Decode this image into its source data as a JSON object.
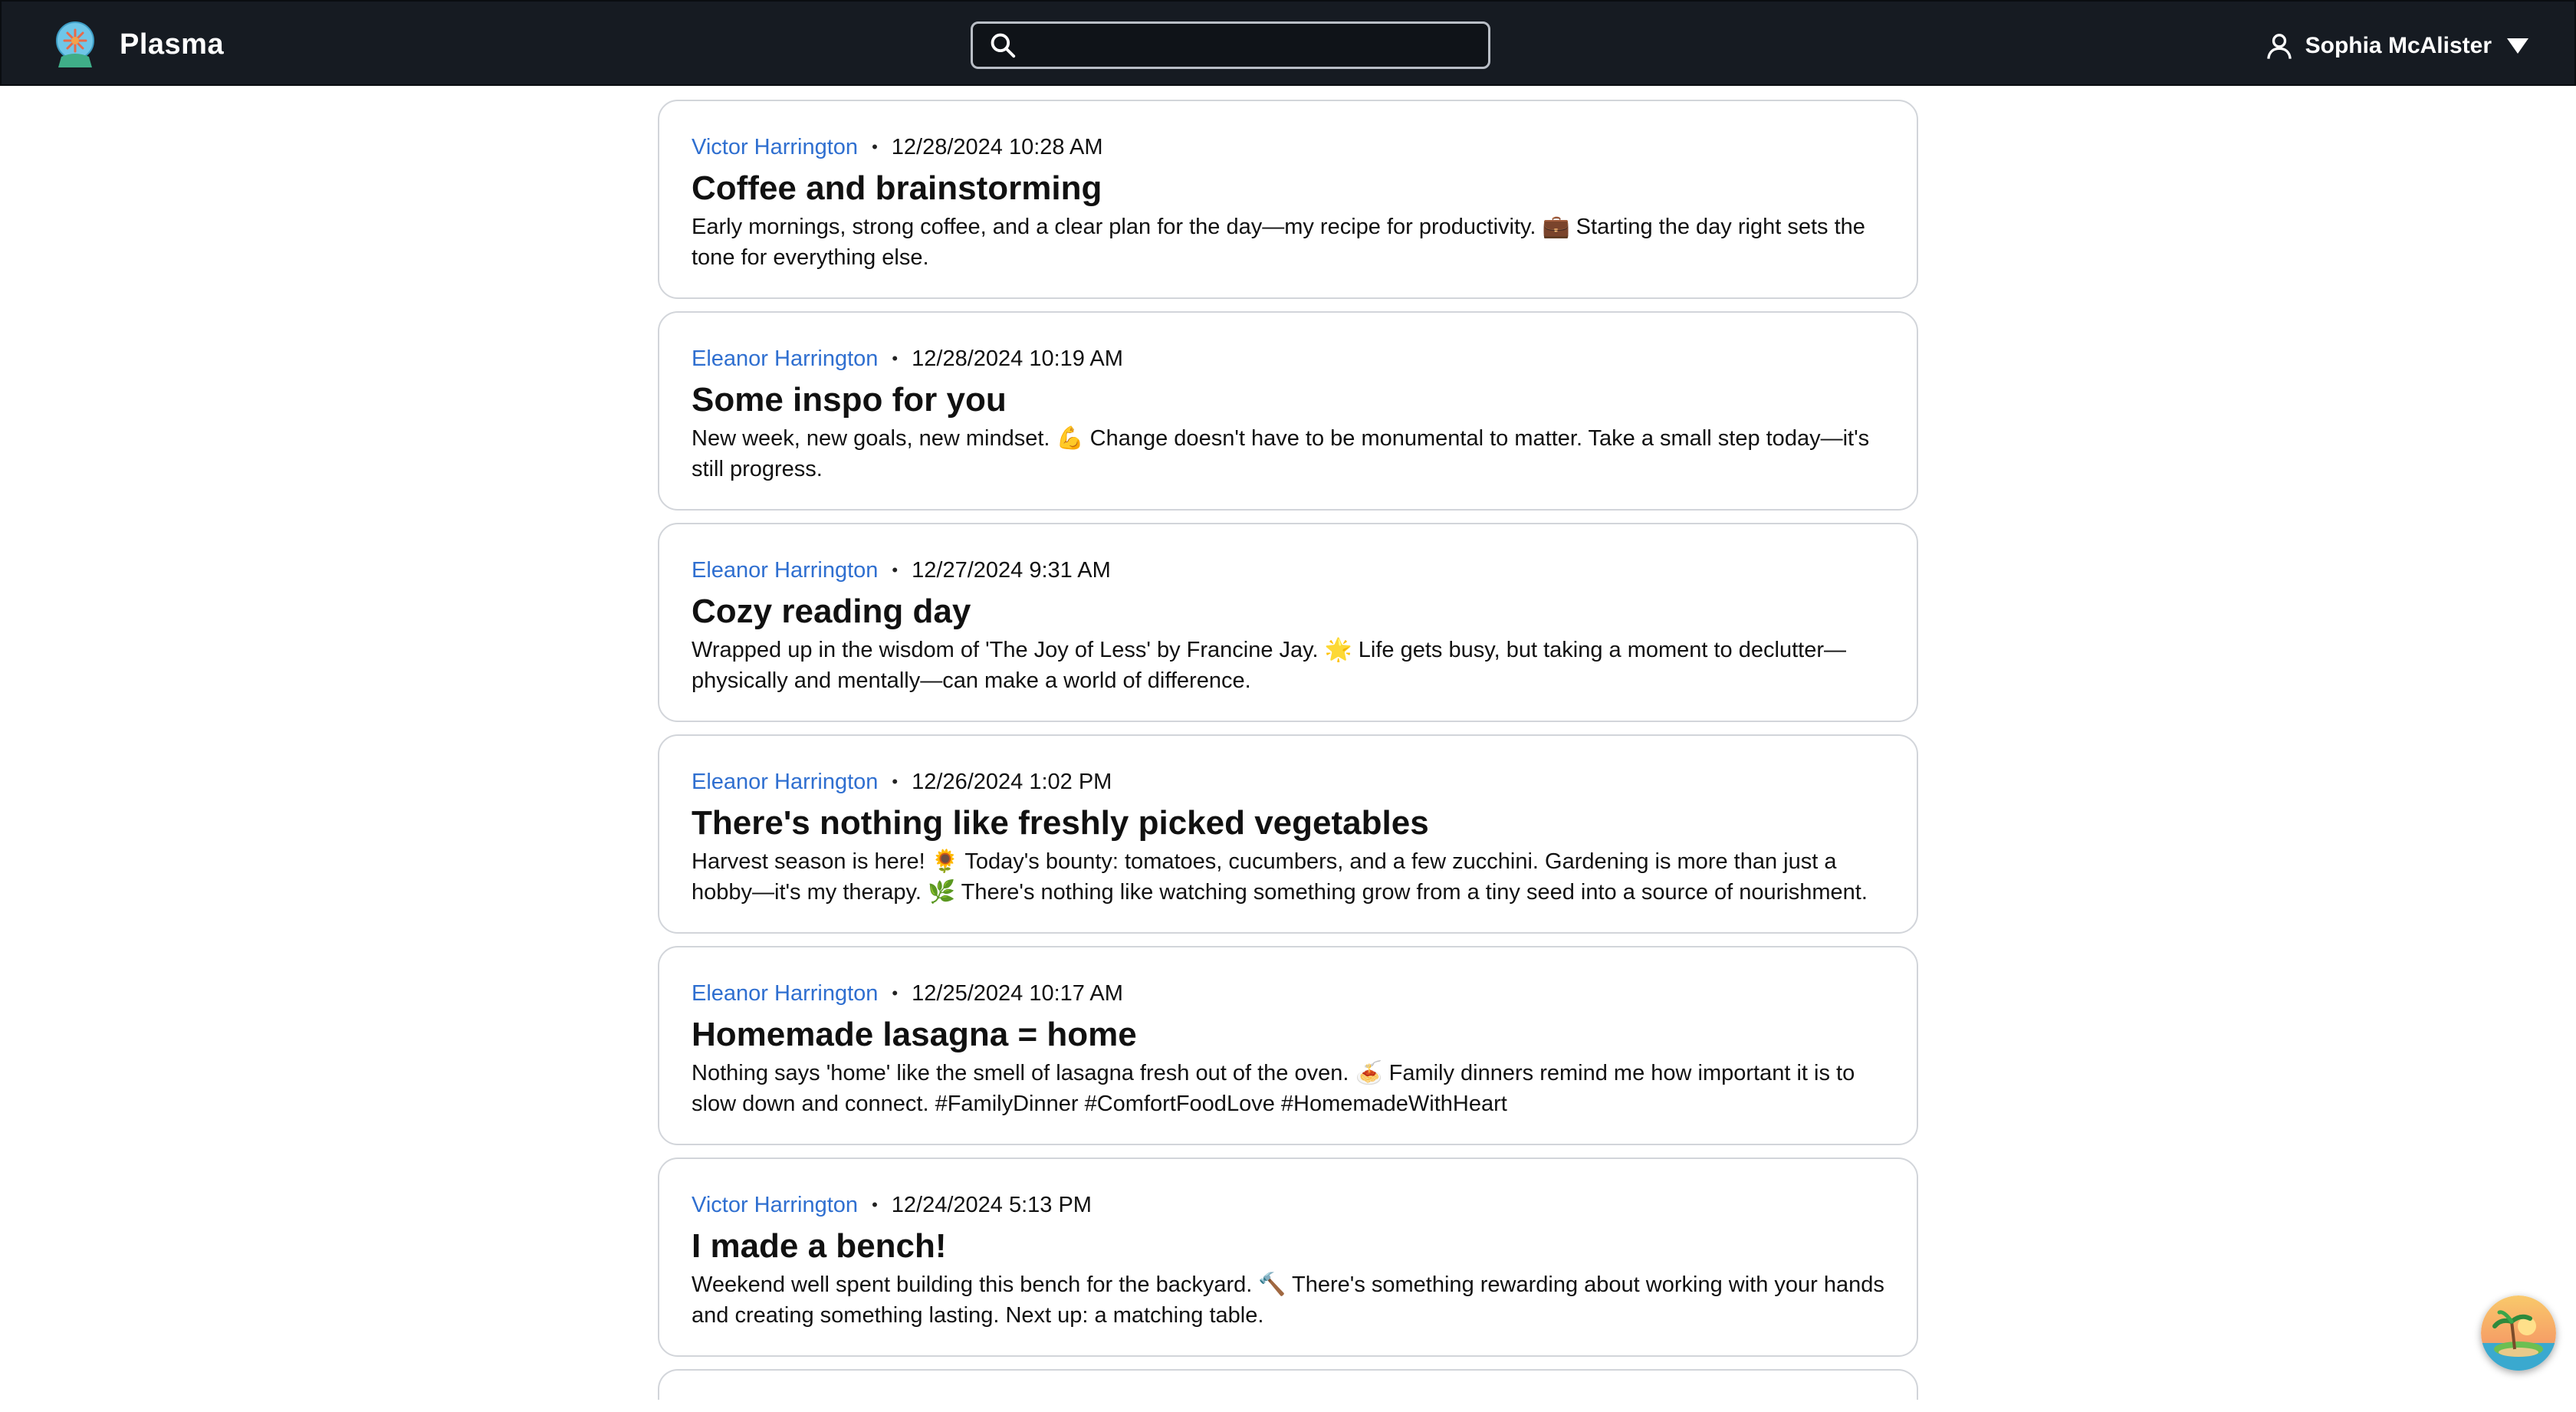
{
  "header": {
    "app_name": "Plasma",
    "search_placeholder": "",
    "user_name": "Sophia McAlister"
  },
  "posts": [
    {
      "author": "Victor Harrington",
      "separator": "•",
      "timestamp": "12/28/2024 10:28 AM",
      "title": "Coffee and brainstorming",
      "body": "Early mornings, strong coffee, and a clear plan for the day—my recipe for productivity. 💼 Starting the day right sets the tone for everything else."
    },
    {
      "author": "Eleanor Harrington",
      "separator": "•",
      "timestamp": "12/28/2024 10:19 AM",
      "title": "Some inspo for you",
      "body": "New week, new goals, new mindset. 💪 Change doesn't have to be monumental to matter. Take a small step today—it's still progress."
    },
    {
      "author": "Eleanor Harrington",
      "separator": "•",
      "timestamp": "12/27/2024 9:31 AM",
      "title": "Cozy reading day",
      "body": "Wrapped up in the wisdom of 'The Joy of Less' by Francine Jay. 🌟 Life gets busy, but taking a moment to declutter—physically and mentally—can make a world of difference."
    },
    {
      "author": "Eleanor Harrington",
      "separator": "•",
      "timestamp": "12/26/2024 1:02 PM",
      "title": "There's nothing like freshly picked vegetables",
      "body": "Harvest season is here! 🌻 Today's bounty: tomatoes, cucumbers, and a few zucchini. Gardening is more than just a hobby—it's my therapy. 🌿 There's nothing like watching something grow from a tiny seed into a source of nourishment."
    },
    {
      "author": "Eleanor Harrington",
      "separator": "•",
      "timestamp": "12/25/2024 10:17 AM",
      "title": "Homemade lasagna = home",
      "body": "Nothing says 'home' like the smell of lasagna fresh out of the oven. 🍝 Family dinners remind me how important it is to slow down and connect. #FamilyDinner #ComfortFoodLove #HomemadeWithHeart"
    },
    {
      "author": "Victor Harrington",
      "separator": "•",
      "timestamp": "12/24/2024 5:13 PM",
      "title": "I made a bench!",
      "body": "Weekend well spent building this bench for the backyard. 🔨 There's something rewarding about working with your hands and creating something lasting. Next up: a matching table."
    }
  ],
  "colors": {
    "header_bg": "#161b22",
    "author_link": "#2f6fd0",
    "card_border": "#d2d5da"
  },
  "icons": {
    "logo": "snow-globe-logo",
    "search": "search-icon",
    "user": "user-icon",
    "menu": "chevron-down-icon",
    "assistant": "island-avatar-icon"
  }
}
